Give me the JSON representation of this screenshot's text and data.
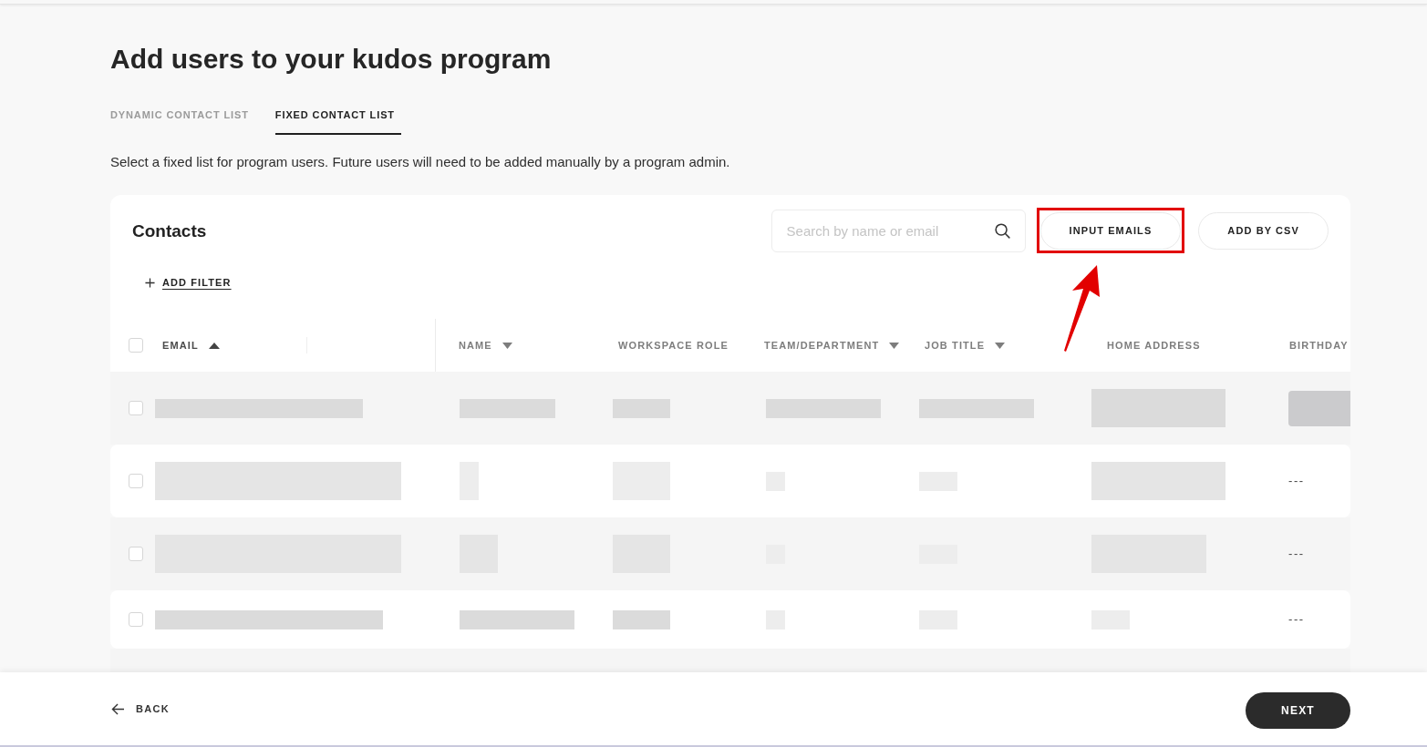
{
  "page": {
    "title": "Add users to your kudos program"
  },
  "tabs": [
    {
      "label": "DYNAMIC CONTACT LIST",
      "selected": false
    },
    {
      "label": "FIXED CONTACT LIST",
      "selected": true
    }
  ],
  "description": "Select a fixed list for program users. Future users will need to be added manually by a program admin.",
  "contacts": {
    "title": "Contacts",
    "search": {
      "placeholder": "Search by name or email"
    },
    "buttons": [
      {
        "label": "INPUT EMAILS",
        "highlighted": true
      },
      {
        "label": "ADD BY CSV",
        "highlighted": false
      }
    ],
    "add_filter": "ADD FILTER",
    "select_all": {
      "checked": false
    },
    "columns": [
      {
        "label": "EMAIL",
        "kind": "sorted"
      },
      {
        "label": "NAME",
        "kind": "dropdown"
      },
      {
        "label": "WORKSPACE ROLE",
        "kind": "plain"
      },
      {
        "label": "TEAM/DEPARTMENT",
        "kind": "dropdown"
      },
      {
        "label": "JOB TITLE",
        "kind": "dropdown"
      },
      {
        "label": "HOME ADDRESS",
        "kind": "plain"
      },
      {
        "label": "BIRTHDAY",
        "kind": "plain"
      }
    ],
    "rows": [
      {
        "checked": false
      },
      {
        "checked": false,
        "birthday": "---"
      },
      {
        "checked": false,
        "birthday": "---"
      },
      {
        "checked": false,
        "birthday": "---"
      }
    ]
  },
  "footer": {
    "back": "BACK",
    "next": "NEXT"
  }
}
